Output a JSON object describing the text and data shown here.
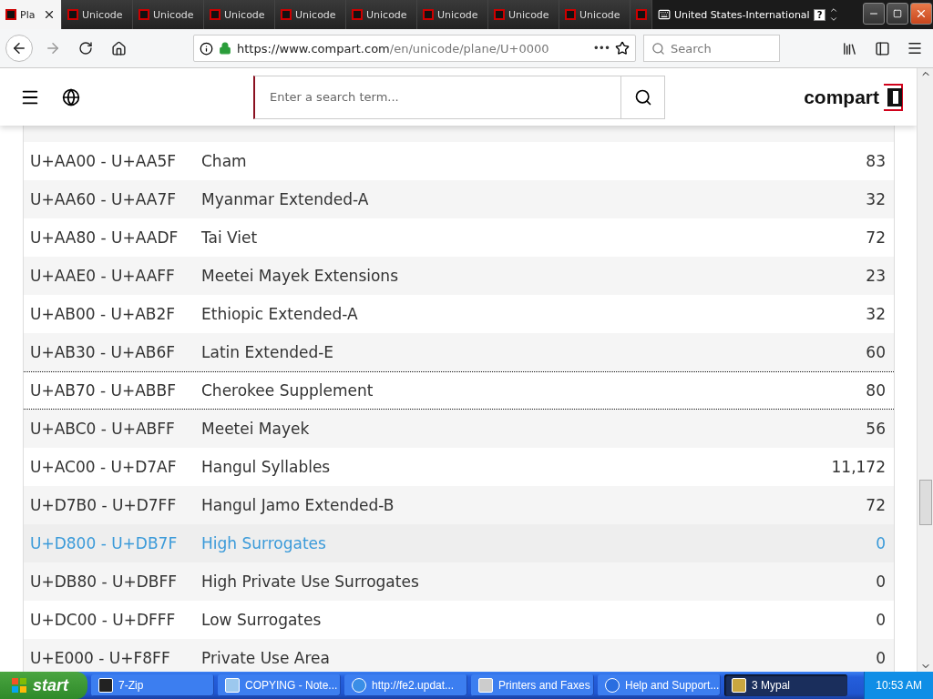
{
  "tabs": [
    {
      "label": "Pla",
      "selected": true
    },
    {
      "label": "Unicode",
      "selected": false
    },
    {
      "label": "Unicode",
      "selected": false
    },
    {
      "label": "Unicode",
      "selected": false
    },
    {
      "label": "Unicode",
      "selected": false
    },
    {
      "label": "Unicode",
      "selected": false
    },
    {
      "label": "Unicode",
      "selected": false
    },
    {
      "label": "Unicode",
      "selected": false
    },
    {
      "label": "Unicode",
      "selected": false
    }
  ],
  "language_bar": {
    "label": "United States-International",
    "help": "?"
  },
  "address_bar": {
    "url_host": "https://www.compart.com",
    "url_path": "/en/unicode/plane/U+0000",
    "more": "•••"
  },
  "search_bar": {
    "placeholder": "Search"
  },
  "site_header": {
    "search": {
      "placeholder": "Enter a search term..."
    },
    "logo": "compart"
  },
  "table": {
    "rows": [
      {
        "range": "U+AA00 - U+AA5F",
        "name": "Cham",
        "count": "83",
        "highlighted": false,
        "focused": false
      },
      {
        "range": "U+AA60 - U+AA7F",
        "name": "Myanmar Extended-A",
        "count": "32",
        "highlighted": false,
        "focused": false
      },
      {
        "range": "U+AA80 - U+AADF",
        "name": "Tai Viet",
        "count": "72",
        "highlighted": false,
        "focused": false
      },
      {
        "range": "U+AAE0 - U+AAFF",
        "name": "Meetei Mayek Extensions",
        "count": "23",
        "highlighted": false,
        "focused": false
      },
      {
        "range": "U+AB00 - U+AB2F",
        "name": "Ethiopic Extended-A",
        "count": "32",
        "highlighted": false,
        "focused": false
      },
      {
        "range": "U+AB30 - U+AB6F",
        "name": "Latin Extended-E",
        "count": "60",
        "highlighted": false,
        "focused": false
      },
      {
        "range": "U+AB70 - U+ABBF",
        "name": "Cherokee Supplement",
        "count": "80",
        "highlighted": false,
        "focused": true
      },
      {
        "range": "U+ABC0 - U+ABFF",
        "name": "Meetei Mayek",
        "count": "56",
        "highlighted": false,
        "focused": false
      },
      {
        "range": "U+AC00 - U+D7AF",
        "name": "Hangul Syllables",
        "count": "11,172",
        "highlighted": false,
        "focused": false
      },
      {
        "range": "U+D7B0 - U+D7FF",
        "name": "Hangul Jamo Extended-B",
        "count": "72",
        "highlighted": false,
        "focused": false
      },
      {
        "range": "U+D800 - U+DB7F",
        "name": "High Surrogates",
        "count": "0",
        "highlighted": true,
        "focused": false
      },
      {
        "range": "U+DB80 - U+DBFF",
        "name": "High Private Use Surrogates",
        "count": "0",
        "highlighted": false,
        "focused": false
      },
      {
        "range": "U+DC00 - U+DFFF",
        "name": "Low Surrogates",
        "count": "0",
        "highlighted": false,
        "focused": false
      },
      {
        "range": "U+E000 - U+F8FF",
        "name": "Private Use Area",
        "count": "0",
        "highlighted": false,
        "focused": false
      }
    ]
  },
  "taskbar": {
    "start": "start",
    "items": [
      {
        "label": "7-Zip",
        "kind": "zip",
        "selected": false
      },
      {
        "label": "COPYING - Note...",
        "kind": "notepad",
        "selected": false
      },
      {
        "label": "http://fe2.updat...",
        "kind": "ie",
        "selected": false
      },
      {
        "label": "Printers and Faxes",
        "kind": "printer",
        "selected": false
      },
      {
        "label": "Help and Support...",
        "kind": "help",
        "selected": false
      },
      {
        "label": "3 Mypal",
        "kind": "mypal",
        "selected": true
      }
    ],
    "clock": "10:53 AM"
  }
}
